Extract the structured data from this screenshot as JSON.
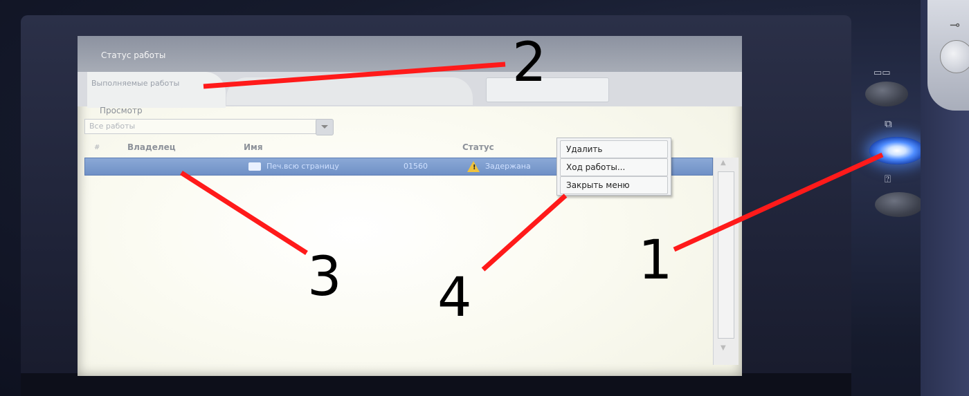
{
  "screen": {
    "title": "Статус работы",
    "tabs": [
      {
        "label": "Выполняемые работы",
        "active": true
      },
      {
        "label": "",
        "active": false
      },
      {
        "label": "",
        "active": false
      }
    ],
    "view": {
      "label": "Просмотр",
      "selected": "Все работы"
    },
    "table": {
      "columns": [
        "#",
        "Владелец",
        "Имя",
        "Статус"
      ],
      "rows": [
        {
          "name": "Печ.всю страницу",
          "id": "01560",
          "status": "Задержана"
        }
      ]
    },
    "popup_menu": {
      "items": [
        "Удалить",
        "Ход работы...",
        "Закрыть меню"
      ]
    }
  },
  "annotations": [
    "1",
    "2",
    "3",
    "4"
  ],
  "colors": {
    "annotation_line": "#ff1a1a",
    "selected_row": "#7b9bd0",
    "led": "#4f8dff"
  }
}
